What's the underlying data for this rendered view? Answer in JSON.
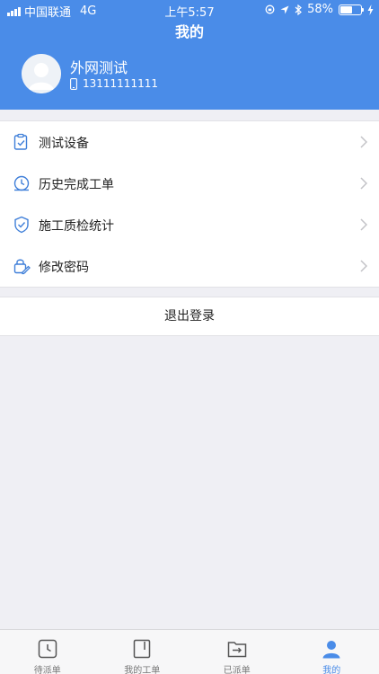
{
  "status_bar": {
    "carrier": "中国联通",
    "network": "4G",
    "time": "上午5:57",
    "battery_pct": "58%"
  },
  "header": {
    "title": "我的",
    "user_name": "外网测试",
    "phone": "13111111111"
  },
  "menu": {
    "items": [
      {
        "label": "测试设备",
        "icon": "clipboard-check-icon"
      },
      {
        "label": "历史完成工单",
        "icon": "clock-history-icon"
      },
      {
        "label": "施工质检统计",
        "icon": "shield-check-icon"
      },
      {
        "label": "修改密码",
        "icon": "lock-edit-icon"
      }
    ]
  },
  "logout_label": "退出登录",
  "tabbar": {
    "tabs": [
      {
        "label": "待派单",
        "icon": "clock-square-icon",
        "active": false
      },
      {
        "label": "我的工单",
        "icon": "document-icon",
        "active": false
      },
      {
        "label": "已派单",
        "icon": "folder-arrow-icon",
        "active": false
      },
      {
        "label": "我的",
        "icon": "user-icon",
        "active": true
      }
    ]
  },
  "colors": {
    "primary": "#4a8ce8",
    "icon_blue": "#3f7fd9",
    "background": "#efeff4"
  }
}
